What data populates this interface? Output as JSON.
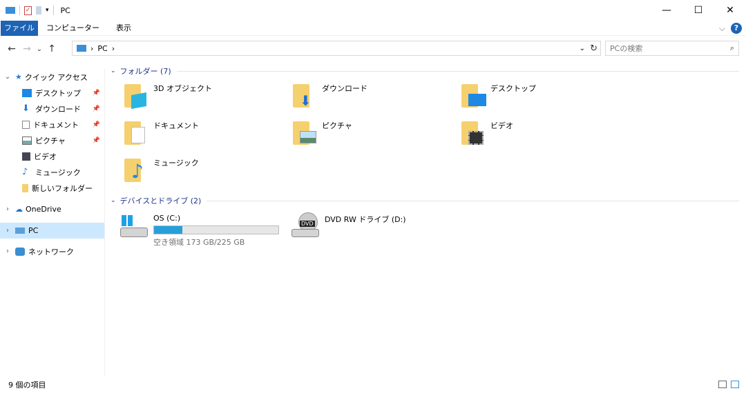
{
  "window": {
    "title": "PC",
    "minimize": "—",
    "maximize": "☐",
    "close": "✕"
  },
  "ribbon": {
    "tabs": [
      "ファイル",
      "コンピューター",
      "表示"
    ],
    "help": "?",
    "expand": "⌵"
  },
  "nav": {
    "back": "←",
    "forward": "→",
    "recent": "⌄",
    "up": "↑",
    "path": [
      "PC"
    ],
    "search_placeholder": "PCの検索"
  },
  "sidebar": {
    "quick_access": "クイック アクセス",
    "quick_items": [
      {
        "label": "デスクトップ",
        "pinned": true
      },
      {
        "label": "ダウンロード",
        "pinned": true
      },
      {
        "label": "ドキュメント",
        "pinned": true
      },
      {
        "label": "ピクチャ",
        "pinned": true
      },
      {
        "label": "ビデオ"
      },
      {
        "label": "ミュージック"
      },
      {
        "label": "新しいフォルダー"
      }
    ],
    "onedrive": "OneDrive",
    "pc": "PC",
    "network": "ネットワーク"
  },
  "folders": {
    "header": "フォルダー (7)",
    "items": [
      "3D オブジェクト",
      "ダウンロード",
      "デスクトップ",
      "ドキュメント",
      "ピクチャ",
      "ビデオ",
      "ミュージック"
    ]
  },
  "drives": {
    "header": "デバイスとドライブ (2)",
    "items": [
      {
        "name": "OS (C:)",
        "free": "空き領域 173 GB/225 GB",
        "used_percent": 23
      },
      {
        "name": "DVD RW ドライブ (D:)",
        "badge": "DVD"
      }
    ]
  },
  "status": {
    "count": "9 個の項目"
  },
  "colors": {
    "accent": "#1e63b4",
    "folder": "#f5d06e",
    "bar": "#26a0da",
    "selected": "#cce8ff"
  }
}
